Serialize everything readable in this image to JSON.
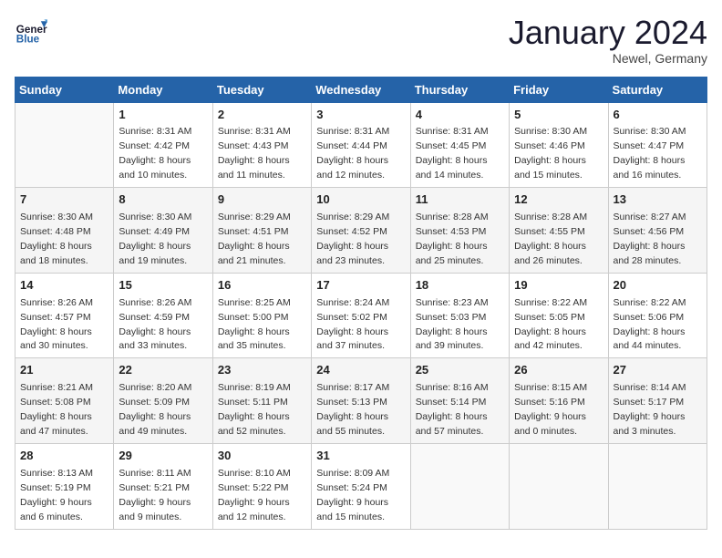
{
  "header": {
    "logo_general": "General",
    "logo_blue": "Blue",
    "month_title": "January 2024",
    "location": "Newel, Germany"
  },
  "days_of_week": [
    "Sunday",
    "Monday",
    "Tuesday",
    "Wednesday",
    "Thursday",
    "Friday",
    "Saturday"
  ],
  "weeks": [
    [
      {
        "day": "",
        "info": ""
      },
      {
        "day": "1",
        "info": "Sunrise: 8:31 AM\nSunset: 4:42 PM\nDaylight: 8 hours\nand 10 minutes."
      },
      {
        "day": "2",
        "info": "Sunrise: 8:31 AM\nSunset: 4:43 PM\nDaylight: 8 hours\nand 11 minutes."
      },
      {
        "day": "3",
        "info": "Sunrise: 8:31 AM\nSunset: 4:44 PM\nDaylight: 8 hours\nand 12 minutes."
      },
      {
        "day": "4",
        "info": "Sunrise: 8:31 AM\nSunset: 4:45 PM\nDaylight: 8 hours\nand 14 minutes."
      },
      {
        "day": "5",
        "info": "Sunrise: 8:30 AM\nSunset: 4:46 PM\nDaylight: 8 hours\nand 15 minutes."
      },
      {
        "day": "6",
        "info": "Sunrise: 8:30 AM\nSunset: 4:47 PM\nDaylight: 8 hours\nand 16 minutes."
      }
    ],
    [
      {
        "day": "7",
        "info": "Sunrise: 8:30 AM\nSunset: 4:48 PM\nDaylight: 8 hours\nand 18 minutes."
      },
      {
        "day": "8",
        "info": "Sunrise: 8:30 AM\nSunset: 4:49 PM\nDaylight: 8 hours\nand 19 minutes."
      },
      {
        "day": "9",
        "info": "Sunrise: 8:29 AM\nSunset: 4:51 PM\nDaylight: 8 hours\nand 21 minutes."
      },
      {
        "day": "10",
        "info": "Sunrise: 8:29 AM\nSunset: 4:52 PM\nDaylight: 8 hours\nand 23 minutes."
      },
      {
        "day": "11",
        "info": "Sunrise: 8:28 AM\nSunset: 4:53 PM\nDaylight: 8 hours\nand 25 minutes."
      },
      {
        "day": "12",
        "info": "Sunrise: 8:28 AM\nSunset: 4:55 PM\nDaylight: 8 hours\nand 26 minutes."
      },
      {
        "day": "13",
        "info": "Sunrise: 8:27 AM\nSunset: 4:56 PM\nDaylight: 8 hours\nand 28 minutes."
      }
    ],
    [
      {
        "day": "14",
        "info": "Sunrise: 8:26 AM\nSunset: 4:57 PM\nDaylight: 8 hours\nand 30 minutes."
      },
      {
        "day": "15",
        "info": "Sunrise: 8:26 AM\nSunset: 4:59 PM\nDaylight: 8 hours\nand 33 minutes."
      },
      {
        "day": "16",
        "info": "Sunrise: 8:25 AM\nSunset: 5:00 PM\nDaylight: 8 hours\nand 35 minutes."
      },
      {
        "day": "17",
        "info": "Sunrise: 8:24 AM\nSunset: 5:02 PM\nDaylight: 8 hours\nand 37 minutes."
      },
      {
        "day": "18",
        "info": "Sunrise: 8:23 AM\nSunset: 5:03 PM\nDaylight: 8 hours\nand 39 minutes."
      },
      {
        "day": "19",
        "info": "Sunrise: 8:22 AM\nSunset: 5:05 PM\nDaylight: 8 hours\nand 42 minutes."
      },
      {
        "day": "20",
        "info": "Sunrise: 8:22 AM\nSunset: 5:06 PM\nDaylight: 8 hours\nand 44 minutes."
      }
    ],
    [
      {
        "day": "21",
        "info": "Sunrise: 8:21 AM\nSunset: 5:08 PM\nDaylight: 8 hours\nand 47 minutes."
      },
      {
        "day": "22",
        "info": "Sunrise: 8:20 AM\nSunset: 5:09 PM\nDaylight: 8 hours\nand 49 minutes."
      },
      {
        "day": "23",
        "info": "Sunrise: 8:19 AM\nSunset: 5:11 PM\nDaylight: 8 hours\nand 52 minutes."
      },
      {
        "day": "24",
        "info": "Sunrise: 8:17 AM\nSunset: 5:13 PM\nDaylight: 8 hours\nand 55 minutes."
      },
      {
        "day": "25",
        "info": "Sunrise: 8:16 AM\nSunset: 5:14 PM\nDaylight: 8 hours\nand 57 minutes."
      },
      {
        "day": "26",
        "info": "Sunrise: 8:15 AM\nSunset: 5:16 PM\nDaylight: 9 hours\nand 0 minutes."
      },
      {
        "day": "27",
        "info": "Sunrise: 8:14 AM\nSunset: 5:17 PM\nDaylight: 9 hours\nand 3 minutes."
      }
    ],
    [
      {
        "day": "28",
        "info": "Sunrise: 8:13 AM\nSunset: 5:19 PM\nDaylight: 9 hours\nand 6 minutes."
      },
      {
        "day": "29",
        "info": "Sunrise: 8:11 AM\nSunset: 5:21 PM\nDaylight: 9 hours\nand 9 minutes."
      },
      {
        "day": "30",
        "info": "Sunrise: 8:10 AM\nSunset: 5:22 PM\nDaylight: 9 hours\nand 12 minutes."
      },
      {
        "day": "31",
        "info": "Sunrise: 8:09 AM\nSunset: 5:24 PM\nDaylight: 9 hours\nand 15 minutes."
      },
      {
        "day": "",
        "info": ""
      },
      {
        "day": "",
        "info": ""
      },
      {
        "day": "",
        "info": ""
      }
    ]
  ]
}
